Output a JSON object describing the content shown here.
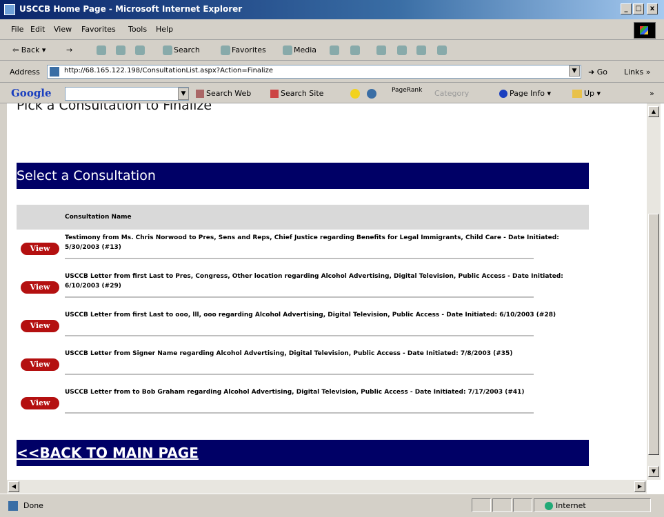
{
  "window": {
    "title": "USCCB Home Page - Microsoft Internet Explorer",
    "minimize": "_",
    "maximize": "□",
    "close": "x"
  },
  "menu": [
    "File",
    "Edit",
    "View",
    "Favorites",
    "Tools",
    "Help"
  ],
  "toolbar": {
    "back": "Back",
    "forward": "→",
    "search": "Search",
    "favorites": "Favorites",
    "media": "Media"
  },
  "address": {
    "label": "Address",
    "url": "http://68.165.122.198/ConsultationList.aspx?Action=Finalize",
    "go": "Go",
    "links": "Links"
  },
  "google_bar": {
    "logo": "Google",
    "search_web": "Search Web",
    "search_site": "Search Site",
    "pagerank": "PageRank",
    "category": "Category",
    "page_info": "Page Info",
    "up": "Up"
  },
  "page": {
    "pick_title": "Pick a Consultation to Finalize",
    "select_header": "Select a Consultation",
    "column_header": "Consultation Name",
    "view_label": "View",
    "back_link": "<<BACK TO MAIN PAGE",
    "consultations": [
      {
        "text": "Testimony from Ms. Chris Norwood to Pres, Sens and Reps, Chief Justice regarding Benefits for Legal Immigrants, Child Care - Date Initiated: 5/30/2003 (#13)"
      },
      {
        "text": "USCCB Letter from first Last to Pres, Congress, Other location regarding Alcohol Advertising, Digital Television, Public Access - Date Initiated: 6/10/2003 (#29)"
      },
      {
        "text": "USCCB Letter from first Last to ooo, lll, ooo regarding Alcohol Advertising, Digital Television, Public Access - Date Initiated: 6/10/2003 (#28)"
      },
      {
        "text": "USCCB Letter from Signer Name regarding Alcohol Advertising, Digital Television, Public Access - Date Initiated: 7/8/2003 (#35)"
      },
      {
        "text": "USCCB Letter from to Bob Graham regarding Alcohol Advertising, Digital Television, Public Access - Date Initiated: 7/17/2003 (#41)"
      }
    ]
  },
  "status": {
    "text": "Done",
    "zone": "Internet"
  },
  "colors": {
    "header_bar": "#000066",
    "view_button": "#b41010",
    "column_header_bg": "#d9d9d9"
  }
}
